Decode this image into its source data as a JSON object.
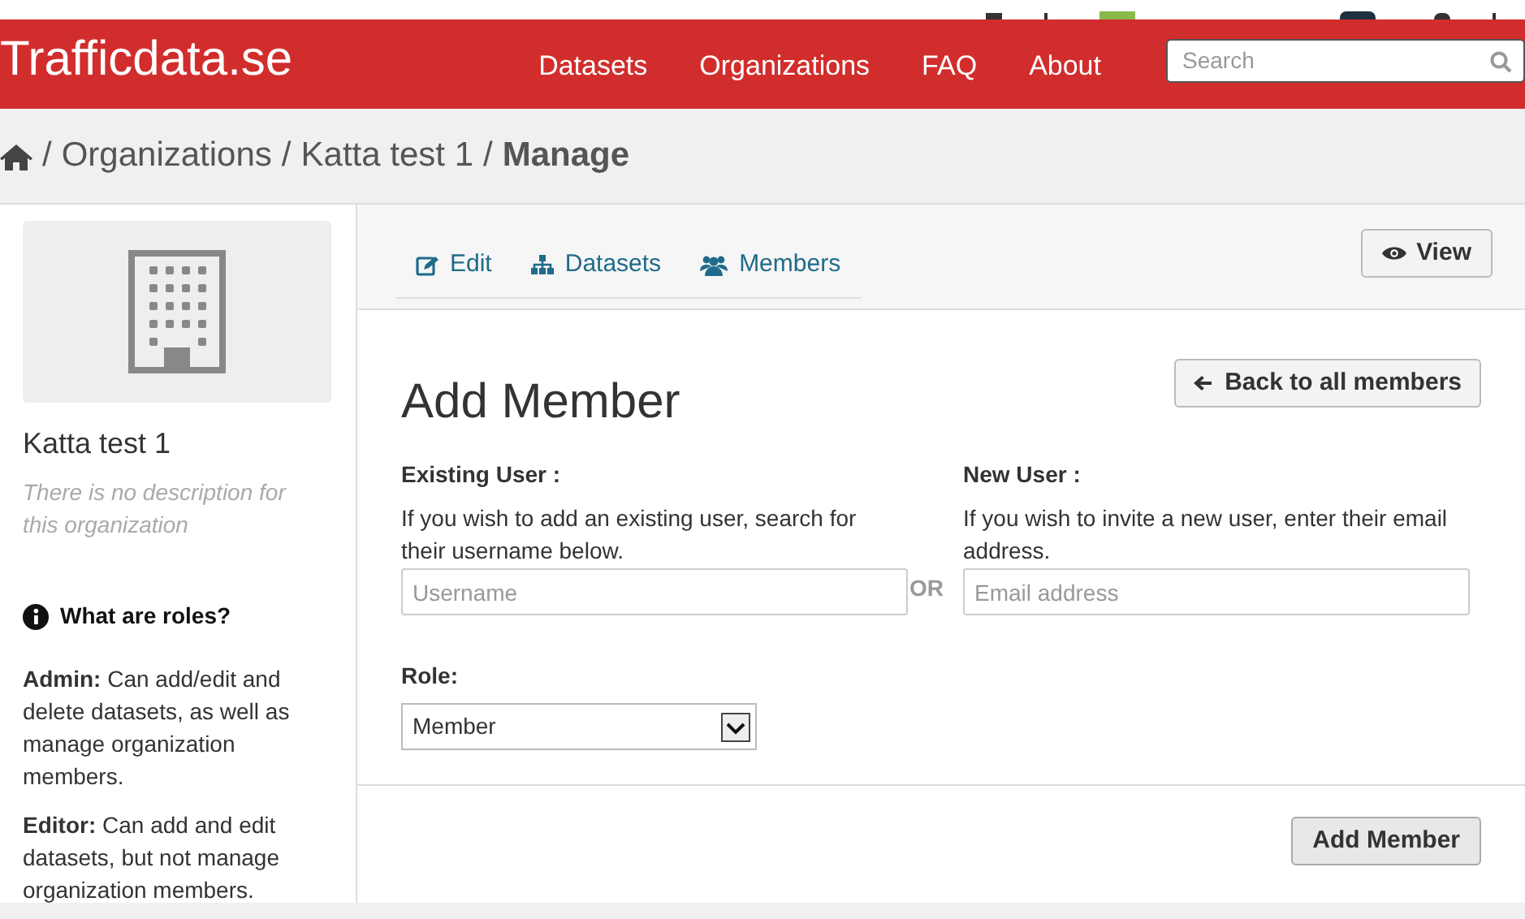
{
  "header": {
    "brand": "Trafficdata.se",
    "nav": [
      "Datasets",
      "Organizations",
      "FAQ",
      "About"
    ],
    "search": {
      "placeholder": "Search"
    }
  },
  "breadcrumb": {
    "items": [
      {
        "separator": "/",
        "label": "Organizations"
      },
      {
        "separator": "/",
        "label": "Katta test 1"
      }
    ],
    "current_separator": "/",
    "current": "Manage"
  },
  "sidebar": {
    "title": "Katta test 1",
    "description": "There is no description for this organization",
    "roles_heading": "What are roles?",
    "roles": [
      {
        "name": "Admin:",
        "text": "Can add/edit and delete datasets, as well as manage organization members."
      },
      {
        "name": "Editor:",
        "text": "Can add and edit datasets, but not manage organization members."
      }
    ]
  },
  "tabs": [
    {
      "label": "Edit",
      "selected": false
    },
    {
      "label": "Datasets",
      "selected": false
    },
    {
      "label": "Members",
      "selected": false
    }
  ],
  "view_button": "View",
  "form": {
    "title": "Add Member",
    "back_button": "Back to all members",
    "existing": {
      "label": "Existing User :",
      "help": "If you wish to add an existing user, search for their username below.",
      "placeholder": "Username"
    },
    "or": "OR",
    "new": {
      "label": "New User :",
      "help": "If you wish to invite a new user, enter their email address.",
      "placeholder": "Email address"
    },
    "role": {
      "label": "Role:",
      "value": "Member"
    },
    "submit": "Add Member"
  }
}
